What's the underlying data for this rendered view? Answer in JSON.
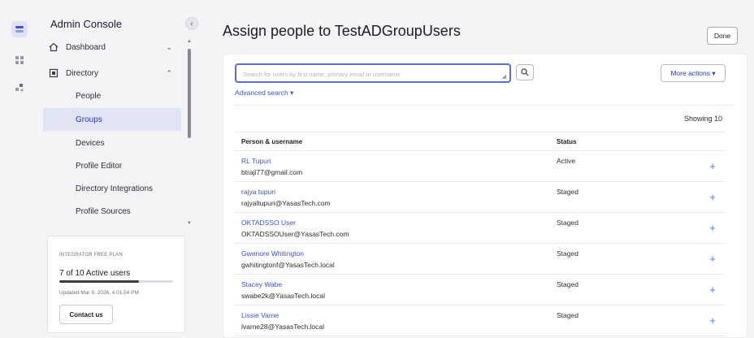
{
  "rail": {
    "icons": [
      "dashboard-app-icon",
      "apps-grid-icon",
      "integrations-icon"
    ]
  },
  "sidebar": {
    "title": "Admin Console",
    "items": [
      {
        "label": "Dashboard",
        "icon": "home-icon",
        "expanded": false
      },
      {
        "label": "Directory",
        "icon": "directory-icon",
        "expanded": true
      }
    ],
    "directory_sub": [
      {
        "label": "People"
      },
      {
        "label": "Groups",
        "selected": true
      },
      {
        "label": "Devices"
      },
      {
        "label": "Profile Editor"
      },
      {
        "label": "Directory Integrations"
      },
      {
        "label": "Profile Sources"
      }
    ],
    "plan": {
      "tag": "INTEGRATOR FREE PLAN",
      "users": "7 of 10 Active users",
      "usage_fraction": 0.7,
      "updated": "Updated Mar 9, 2026, 4:01:54 PM",
      "contact_label": "Contact us"
    }
  },
  "main": {
    "title": "Assign people to TestADGroupUsers",
    "done_label": "Done",
    "search_placeholder": "Search for users by first name, primary email or username",
    "advanced_search": "Advanced search ▾",
    "more_actions": "More actions ▾",
    "showing": "Showing 10",
    "columns": {
      "person": "Person & username",
      "status": "Status"
    },
    "rows": [
      {
        "name": "RL Tupuri",
        "username": "btraji77@gmail.com",
        "status": "Active"
      },
      {
        "name": "rajya tupuri",
        "username": "rajyaltupuri@YasasTech.com",
        "status": "Staged"
      },
      {
        "name": "OKTADSSO User",
        "username": "OKTADSSOUser@YasasTech.com",
        "status": "Staged"
      },
      {
        "name": "Gwenore Whitington",
        "username": "gwhitingtonf@YasasTech.local",
        "status": "Staged"
      },
      {
        "name": "Stacey Wabe",
        "username": "swabe2k@YasasTech.local",
        "status": "Staged"
      },
      {
        "name": "Lissie Varne",
        "username": "lvarne28@YasasTech.local",
        "status": "Staged"
      }
    ],
    "add_symbol": "+"
  },
  "colors": {
    "accent": "#3f52c7",
    "focus_border": "#5a6fd6",
    "selected_bg": "#e1e4f3",
    "panel_bg": "#f4f4f6"
  }
}
